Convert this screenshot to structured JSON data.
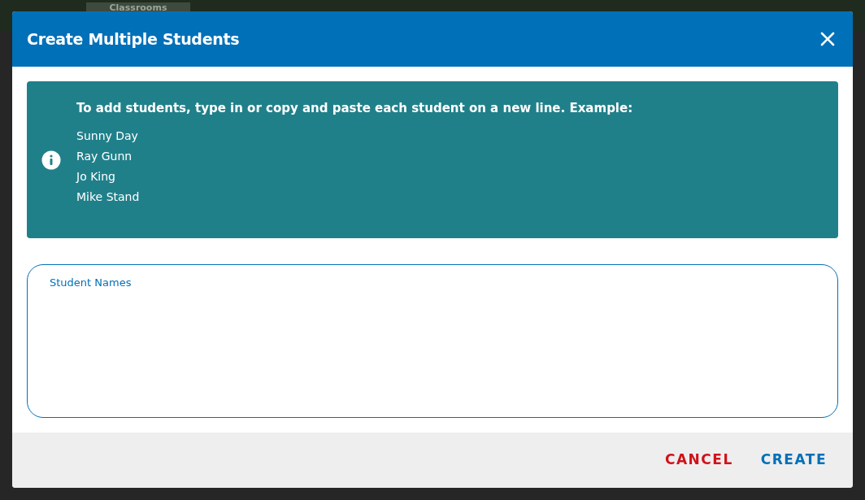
{
  "background": {
    "tab": "Classrooms"
  },
  "dialog": {
    "title": "Create Multiple Students",
    "info": {
      "heading": "To add students, type in or copy and paste each student on a new line. Example:",
      "examples": [
        "Sunny Day",
        "Ray Gunn",
        "Jo King",
        "Mike Stand"
      ]
    },
    "field": {
      "label": "Student Names"
    },
    "buttons": [
      {
        "label": "CANCEL",
        "kind": "cancel"
      },
      {
        "label": "CREATE",
        "kind": "confirm"
      }
    ]
  }
}
